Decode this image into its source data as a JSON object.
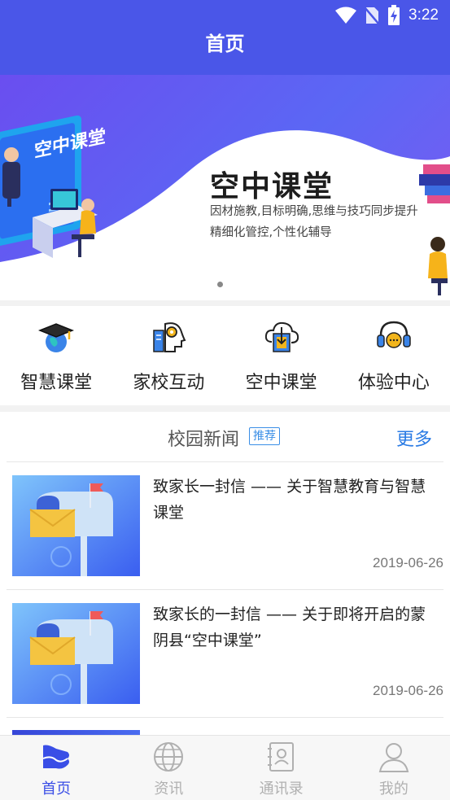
{
  "status_bar": {
    "time": "3:22"
  },
  "header": {
    "title": "首页"
  },
  "banner": {
    "title": "空中课堂",
    "subtitle_line1": "因材施教,目标明确,思维与技巧同步提升",
    "subtitle_line2": "精细化管控,个性化辅导",
    "badge_text": "空中课堂"
  },
  "quick_nav": [
    {
      "label": "智慧课堂",
      "icon": "graduation-globe-icon"
    },
    {
      "label": "家校互动",
      "icon": "head-book-icon"
    },
    {
      "label": "空中课堂",
      "icon": "cloud-download-icon"
    },
    {
      "label": "体验中心",
      "icon": "headset-chat-icon"
    }
  ],
  "news": {
    "title": "校园新闻",
    "badge": "推荐",
    "more": "更多",
    "items": [
      {
        "title": "致家长一封信 —— 关于智慧教育与智慧课堂",
        "date": "2019-06-26",
        "thumb_icon": "mailbox-icon"
      },
      {
        "title": "致家长的一封信  —— 关于即将开启的蒙阴县“空中课堂”",
        "date": "2019-06-26",
        "thumb_icon": "mailbox-icon"
      }
    ]
  },
  "tab_bar": [
    {
      "label": "首页",
      "icon": "home-logo-icon",
      "active": true
    },
    {
      "label": "资讯",
      "icon": "globe-icon",
      "active": false
    },
    {
      "label": "通讯录",
      "icon": "contacts-icon",
      "active": false
    },
    {
      "label": "我的",
      "icon": "user-icon",
      "active": false
    }
  ],
  "colors": {
    "primary": "#4a56e8",
    "accent_blue": "#2a7be4",
    "tab_active": "#3a4ee6"
  }
}
